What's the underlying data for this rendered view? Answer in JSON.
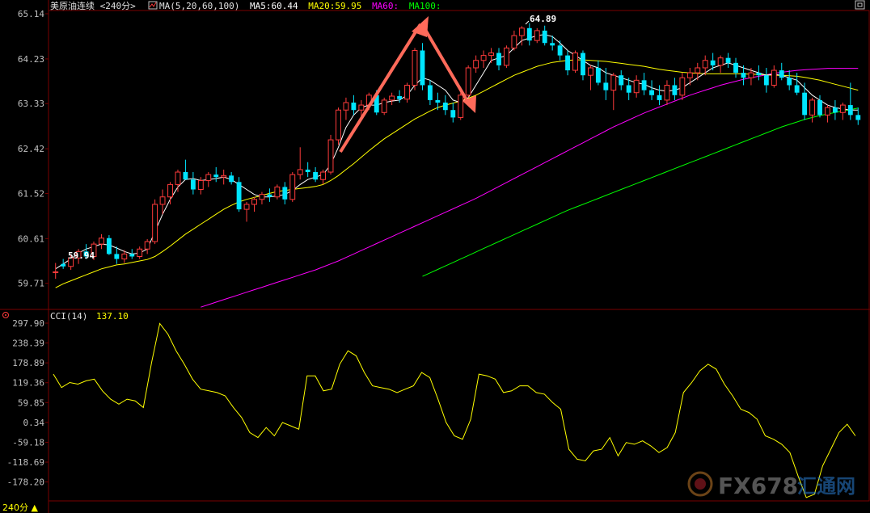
{
  "header": {
    "symbol": "美原油连续",
    "period": "<240分>",
    "ma_label": "MA(5,20,60,100)",
    "ma5": "MA5:60.44",
    "ma20": "MA20:59.95",
    "ma60": "MA60:",
    "ma100": "MA100:"
  },
  "colors": {
    "background": "#000000",
    "up_candle": "#ff3b3b",
    "down_candle": "#00e5ff",
    "ma5": "#ffffff",
    "ma20": "#ffff00",
    "ma60": "#ff00ff",
    "ma100": "#00ff00",
    "cci": "#ffff00",
    "grid": "#7a0000",
    "arrow": "#ff6a5a"
  },
  "indicator": {
    "label": "CCI(14)",
    "value": "137.10"
  },
  "footer": {
    "period_tab": "240分 ▲"
  },
  "watermark": {
    "text": "FX678",
    "text2": "汇通网"
  },
  "chart_data": [
    {
      "type": "candlestick",
      "y_ticks": [
        "65.14",
        "64.23",
        "63.33",
        "62.42",
        "61.52",
        "60.61",
        "59.71"
      ],
      "ylim": [
        59.2,
        65.14
      ],
      "annotations": [
        {
          "text": "64.89",
          "kind": "high"
        },
        {
          "text": "59.94",
          "kind": "low"
        }
      ],
      "candles": [
        [
          59.93,
          60.12,
          59.8,
          59.94
        ],
        [
          60.1,
          60.2,
          60.0,
          60.05
        ],
        [
          60.05,
          60.3,
          59.98,
          60.22
        ],
        [
          60.22,
          60.4,
          60.1,
          60.35
        ],
        [
          60.35,
          60.5,
          60.2,
          60.25
        ],
        [
          60.25,
          60.55,
          60.18,
          60.5
        ],
        [
          60.5,
          60.7,
          60.4,
          60.62
        ],
        [
          60.62,
          60.68,
          60.28,
          60.3
        ],
        [
          60.3,
          60.45,
          60.1,
          60.2
        ],
        [
          60.2,
          60.38,
          60.12,
          60.3
        ],
        [
          60.3,
          60.4,
          60.2,
          60.25
        ],
        [
          60.25,
          60.45,
          60.2,
          60.4
        ],
        [
          60.4,
          60.6,
          60.3,
          60.55
        ],
        [
          60.55,
          61.4,
          60.5,
          61.3
        ],
        [
          61.3,
          61.6,
          61.1,
          61.45
        ],
        [
          61.45,
          61.75,
          61.3,
          61.7
        ],
        [
          61.7,
          62.0,
          61.55,
          61.95
        ],
        [
          61.95,
          62.2,
          61.8,
          61.8
        ],
        [
          61.8,
          61.95,
          61.5,
          61.6
        ],
        [
          61.6,
          61.85,
          61.5,
          61.78
        ],
        [
          61.78,
          61.95,
          61.65,
          61.9
        ],
        [
          61.9,
          62.05,
          61.75,
          61.85
        ],
        [
          61.85,
          62.0,
          61.7,
          61.88
        ],
        [
          61.88,
          61.95,
          61.7,
          61.75
        ],
        [
          61.75,
          61.85,
          61.15,
          61.2
        ],
        [
          61.2,
          61.35,
          60.95,
          61.3
        ],
        [
          61.3,
          61.45,
          61.15,
          61.4
        ],
        [
          61.4,
          61.55,
          61.3,
          61.5
        ],
        [
          61.5,
          61.62,
          61.35,
          61.45
        ],
        [
          61.45,
          61.7,
          61.4,
          61.65
        ],
        [
          61.65,
          61.75,
          61.3,
          61.4
        ],
        [
          61.4,
          61.95,
          61.35,
          61.9
        ],
        [
          61.9,
          62.45,
          61.8,
          62.0
        ],
        [
          62.0,
          62.15,
          61.85,
          61.95
        ],
        [
          61.95,
          62.05,
          61.75,
          61.8
        ],
        [
          61.8,
          62.0,
          61.7,
          61.95
        ],
        [
          61.95,
          62.7,
          61.9,
          62.6
        ],
        [
          62.6,
          63.25,
          62.5,
          63.2
        ],
        [
          63.2,
          63.45,
          63.0,
          63.35
        ],
        [
          63.35,
          63.5,
          63.1,
          63.2
        ],
        [
          63.2,
          63.4,
          63.05,
          63.3
        ],
        [
          63.3,
          63.55,
          63.2,
          63.5
        ],
        [
          63.5,
          63.6,
          63.1,
          63.15
        ],
        [
          63.15,
          63.45,
          63.1,
          63.4
        ],
        [
          63.4,
          63.55,
          63.3,
          63.48
        ],
        [
          63.48,
          63.6,
          63.35,
          63.42
        ],
        [
          63.42,
          63.75,
          63.35,
          63.7
        ],
        [
          63.7,
          64.45,
          63.6,
          64.4
        ],
        [
          64.4,
          64.55,
          63.6,
          63.7
        ],
        [
          63.7,
          63.8,
          63.3,
          63.4
        ],
        [
          63.4,
          63.55,
          63.2,
          63.35
        ],
        [
          63.35,
          63.5,
          63.1,
          63.2
        ],
        [
          63.2,
          63.35,
          62.95,
          63.05
        ],
        [
          63.05,
          63.55,
          63.0,
          63.5
        ],
        [
          63.5,
          64.1,
          63.45,
          64.05
        ],
        [
          64.05,
          64.3,
          63.95,
          64.2
        ],
        [
          64.2,
          64.4,
          64.05,
          64.3
        ],
        [
          64.3,
          64.45,
          64.15,
          64.35
        ],
        [
          64.35,
          64.45,
          64.0,
          64.1
        ],
        [
          64.1,
          64.5,
          64.05,
          64.45
        ],
        [
          64.45,
          64.8,
          64.4,
          64.7
        ],
        [
          64.7,
          64.89,
          64.5,
          64.85
        ],
        [
          64.85,
          64.95,
          64.5,
          64.6
        ],
        [
          64.6,
          64.85,
          64.55,
          64.8
        ],
        [
          64.8,
          64.9,
          64.5,
          64.55
        ],
        [
          64.55,
          64.7,
          64.4,
          64.5
        ],
        [
          64.5,
          64.6,
          64.2,
          64.3
        ],
        [
          64.3,
          64.4,
          63.9,
          64.0
        ],
        [
          64.0,
          64.4,
          63.95,
          64.35
        ],
        [
          64.35,
          64.4,
          63.8,
          63.9
        ],
        [
          63.9,
          64.1,
          63.6,
          64.05
        ],
        [
          64.05,
          64.2,
          63.7,
          63.75
        ],
        [
          63.75,
          64.05,
          63.4,
          63.6
        ],
        [
          63.6,
          63.95,
          63.2,
          63.9
        ],
        [
          63.9,
          64.0,
          63.6,
          63.7
        ],
        [
          63.7,
          63.85,
          63.4,
          63.55
        ],
        [
          63.55,
          63.9,
          63.45,
          63.8
        ],
        [
          63.8,
          63.95,
          63.5,
          63.6
        ],
        [
          63.6,
          63.8,
          63.4,
          63.5
        ],
        [
          63.5,
          63.7,
          63.3,
          63.4
        ],
        [
          63.4,
          63.8,
          63.3,
          63.7
        ],
        [
          63.7,
          63.85,
          63.4,
          63.5
        ],
        [
          63.5,
          63.95,
          63.4,
          63.85
        ],
        [
          63.85,
          64.05,
          63.7,
          63.95
        ],
        [
          63.95,
          64.15,
          63.8,
          64.05
        ],
        [
          64.05,
          64.3,
          63.9,
          64.2
        ],
        [
          64.2,
          64.35,
          64.0,
          64.1
        ],
        [
          64.1,
          64.3,
          63.95,
          64.25
        ],
        [
          64.25,
          64.35,
          64.05,
          64.15
        ],
        [
          64.15,
          64.25,
          63.85,
          63.95
        ],
        [
          63.95,
          64.1,
          63.7,
          63.85
        ],
        [
          63.85,
          64.05,
          63.7,
          63.95
        ],
        [
          63.95,
          64.1,
          63.8,
          63.9
        ],
        [
          63.9,
          64.05,
          63.55,
          63.7
        ],
        [
          63.7,
          64.1,
          63.65,
          64.0
        ],
        [
          64.0,
          64.15,
          63.8,
          63.85
        ],
        [
          63.85,
          64.0,
          63.6,
          63.7
        ],
        [
          63.7,
          63.95,
          63.5,
          63.55
        ],
        [
          63.55,
          63.75,
          63.0,
          63.1
        ],
        [
          63.1,
          63.45,
          62.95,
          63.4
        ],
        [
          63.4,
          63.5,
          63.05,
          63.1
        ],
        [
          63.1,
          63.3,
          62.95,
          63.25
        ],
        [
          63.25,
          63.4,
          63.0,
          63.15
        ],
        [
          63.15,
          63.35,
          63.0,
          63.3
        ],
        [
          63.3,
          63.75,
          63.0,
          63.1
        ],
        [
          63.1,
          63.25,
          62.9,
          63.0
        ]
      ],
      "ma5": [
        60.0,
        60.1,
        60.2,
        60.32,
        60.4,
        60.45,
        60.5,
        60.48,
        60.42,
        60.35,
        60.3,
        60.32,
        60.4,
        60.75,
        61.1,
        61.4,
        61.65,
        61.8,
        61.82,
        61.78,
        61.8,
        61.82,
        61.85,
        61.8,
        61.7,
        61.6,
        61.5,
        61.45,
        61.45,
        61.47,
        61.5,
        61.58,
        61.7,
        61.8,
        61.85,
        61.9,
        62.1,
        62.45,
        62.85,
        63.1,
        63.25,
        63.3,
        63.3,
        63.35,
        63.38,
        63.4,
        63.5,
        63.7,
        63.85,
        63.8,
        63.7,
        63.6,
        63.4,
        63.35,
        63.45,
        63.7,
        63.95,
        64.2,
        64.25,
        64.3,
        64.45,
        64.6,
        64.65,
        64.7,
        64.72,
        64.68,
        64.55,
        64.4,
        64.3,
        64.2,
        64.1,
        64.05,
        63.95,
        63.9,
        63.85,
        63.8,
        63.75,
        63.72,
        63.65,
        63.6,
        63.58,
        63.6,
        63.65,
        63.75,
        63.85,
        63.95,
        64.05,
        64.1,
        64.15,
        64.1,
        64.05,
        64.0,
        63.95,
        63.9,
        63.92,
        63.9,
        63.85,
        63.8,
        63.65,
        63.5,
        63.4,
        63.3,
        63.25,
        63.22,
        63.2,
        63.2
      ],
      "ma20": [
        59.62,
        59.7,
        59.76,
        59.82,
        59.88,
        59.94,
        60.0,
        60.04,
        60.08,
        60.1,
        60.13,
        60.16,
        60.19,
        60.25,
        60.35,
        60.46,
        60.58,
        60.7,
        60.8,
        60.9,
        61.0,
        61.1,
        61.2,
        61.28,
        61.35,
        61.4,
        61.44,
        61.48,
        61.52,
        61.56,
        61.58,
        61.6,
        61.62,
        61.64,
        61.66,
        61.7,
        61.78,
        61.88,
        62.0,
        62.12,
        62.25,
        62.38,
        62.5,
        62.62,
        62.72,
        62.82,
        62.92,
        63.02,
        63.1,
        63.18,
        63.25,
        63.3,
        63.34,
        63.38,
        63.44,
        63.5,
        63.58,
        63.66,
        63.74,
        63.82,
        63.9,
        63.96,
        64.02,
        64.08,
        64.12,
        64.16,
        64.18,
        64.2,
        64.21,
        64.21,
        64.2,
        64.19,
        64.18,
        64.16,
        64.14,
        64.12,
        64.1,
        64.08,
        64.05,
        64.02,
        64.0,
        63.98,
        63.96,
        63.95,
        63.94,
        63.93,
        63.93,
        63.93,
        63.93,
        63.93,
        63.93,
        63.92,
        63.92,
        63.91,
        63.9,
        63.9,
        63.89,
        63.88,
        63.86,
        63.83,
        63.8,
        63.76,
        63.72,
        63.68,
        63.64,
        63.6
      ],
      "ma60_start": 0,
      "ma60": [
        58.4,
        58.44,
        58.48,
        58.52,
        58.56,
        58.6,
        58.64,
        58.68,
        58.72,
        58.76,
        58.8,
        58.84,
        58.88,
        58.93,
        58.98,
        59.03,
        59.08,
        59.13,
        59.18,
        59.23,
        59.28,
        59.33,
        59.38,
        59.43,
        59.48,
        59.53,
        59.58,
        59.63,
        59.68,
        59.73,
        59.78,
        59.83,
        59.88,
        59.93,
        59.98,
        60.04,
        60.1,
        60.16,
        60.23,
        60.3,
        60.37,
        60.44,
        60.51,
        60.58,
        60.65,
        60.72,
        60.79,
        60.86,
        60.93,
        61.0,
        61.07,
        61.14,
        61.21,
        61.28,
        61.35,
        61.42,
        61.5,
        61.58,
        61.66,
        61.74,
        61.82,
        61.9,
        61.98,
        62.06,
        62.14,
        62.22,
        62.3,
        62.38,
        62.46,
        62.54,
        62.62,
        62.7,
        62.78,
        62.86,
        62.93,
        63.0,
        63.07,
        63.14,
        63.2,
        63.26,
        63.32,
        63.38,
        63.44,
        63.5,
        63.55,
        63.6,
        63.65,
        63.7,
        63.74,
        63.78,
        63.82,
        63.85,
        63.88,
        63.91,
        63.94,
        63.96,
        63.98,
        64.0,
        64.01,
        64.02,
        64.03,
        64.04,
        64.04,
        64.04,
        64.04,
        64.04
      ],
      "ma100_start": 48,
      "ma100": [
        59.85,
        59.92,
        59.99,
        60.06,
        60.13,
        60.2,
        60.27,
        60.34,
        60.41,
        60.48,
        60.55,
        60.62,
        60.69,
        60.76,
        60.83,
        60.9,
        60.97,
        61.04,
        61.11,
        61.18,
        61.24,
        61.3,
        61.36,
        61.42,
        61.48,
        61.54,
        61.6,
        61.66,
        61.72,
        61.78,
        61.84,
        61.9,
        61.96,
        62.02,
        62.08,
        62.14,
        62.2,
        62.26,
        62.32,
        62.38,
        62.44,
        62.5,
        62.56,
        62.62,
        62.68,
        62.74,
        62.8,
        62.86,
        62.91,
        62.96,
        63.01,
        63.05,
        63.09,
        63.12,
        63.15,
        63.18,
        63.21,
        63.24
      ]
    },
    {
      "type": "line",
      "name": "CCI(14)",
      "y_ticks": [
        "297.90",
        "238.39",
        "178.89",
        "119.36",
        "59.85",
        "0.34",
        "-59.18",
        "-118.69",
        "-178.20"
      ],
      "ylim": [
        -230,
        297.9
      ],
      "values": [
        145,
        105,
        120,
        115,
        125,
        130,
        95,
        70,
        55,
        70,
        65,
        45,
        180,
        297,
        265,
        215,
        175,
        130,
        100,
        95,
        90,
        80,
        45,
        15,
        -30,
        -45,
        -15,
        -40,
        0,
        -10,
        -20,
        140,
        140,
        95,
        100,
        175,
        215,
        200,
        150,
        110,
        105,
        100,
        90,
        100,
        110,
        150,
        135,
        70,
        0,
        -40,
        -50,
        10,
        145,
        140,
        130,
        90,
        95,
        110,
        110,
        90,
        85,
        60,
        40,
        -80,
        -110,
        -115,
        -85,
        -80,
        -45,
        -100,
        -60,
        -65,
        -55,
        -70,
        -90,
        -75,
        -30,
        90,
        120,
        155,
        175,
        160,
        115,
        80,
        40,
        30,
        10,
        -40,
        -50,
        -65,
        -90,
        -160,
        -225,
        -215,
        -130,
        -80,
        -30,
        -5,
        -40
      ]
    }
  ]
}
